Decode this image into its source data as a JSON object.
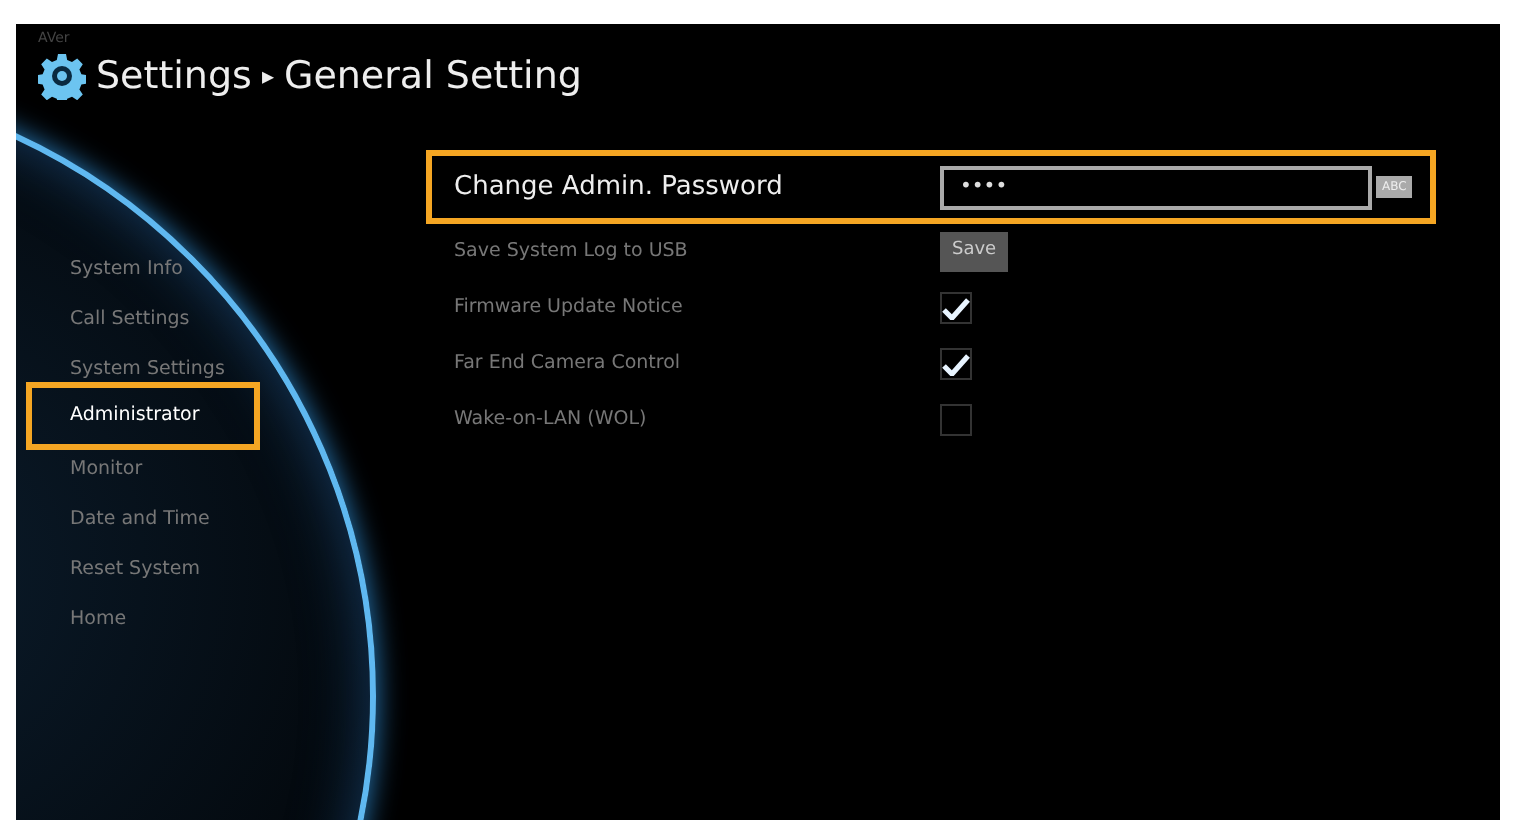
{
  "header": {
    "brand": "AVer",
    "title": "Settings",
    "separator": "▸",
    "subtitle": "General Setting"
  },
  "sidebar": {
    "items": [
      {
        "label": "System Info",
        "selected": false
      },
      {
        "label": "Call Settings",
        "selected": false
      },
      {
        "label": "System Settings",
        "selected": false
      },
      {
        "label": "Administrator",
        "selected": true
      },
      {
        "label": "Monitor",
        "selected": false
      },
      {
        "label": "Date and Time",
        "selected": false
      },
      {
        "label": "Reset System",
        "selected": false
      },
      {
        "label": "Home",
        "selected": false
      }
    ]
  },
  "settings": [
    {
      "kind": "password",
      "label": "Change Admin. Password",
      "value": "••••",
      "tag": "ABC",
      "selected": true
    },
    {
      "kind": "button",
      "label": "Save System Log to USB",
      "button": "Save",
      "selected": false
    },
    {
      "kind": "checkbox",
      "label": "Firmware Update Notice",
      "checked": true,
      "selected": false
    },
    {
      "kind": "checkbox",
      "label": "Far End Camera Control",
      "checked": true,
      "selected": false
    },
    {
      "kind": "checkbox",
      "label": "Wake-on-LAN (WOL)",
      "checked": false,
      "selected": false
    }
  ]
}
